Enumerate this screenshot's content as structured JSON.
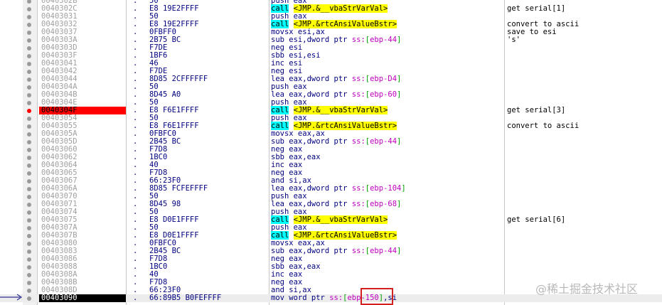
{
  "rows": [
    {
      "addr": "0040302B",
      "hex": "50",
      "asm": "push eax",
      "cmt": ""
    },
    {
      "addr": "0040302C",
      "hex": "E8 19E2FFFF",
      "asm": "call <JMP.&__vbaStrVarVal>",
      "cmt": "get serial[1]"
    },
    {
      "addr": "00403031",
      "hex": "50",
      "asm": "push eax",
      "cmt": ""
    },
    {
      "addr": "00403032",
      "hex": "E8 19E2FFFF",
      "asm": "call <JMP.&rtcAnsiValueBstr>",
      "cmt": "convert to ascii"
    },
    {
      "addr": "00403037",
      "hex": "0FBFF0",
      "asm": "movsx esi,ax",
      "cmt": "save to esi"
    },
    {
      "addr": "0040303A",
      "hex": "2B75 BC",
      "asm": "sub esi,dword ptr ss:[ebp-44]",
      "cmt": "'s'"
    },
    {
      "addr": "0040303D",
      "hex": "F7DE",
      "asm": "neg esi",
      "cmt": ""
    },
    {
      "addr": "0040303F",
      "hex": "1BF6",
      "asm": "sbb esi,esi",
      "cmt": ""
    },
    {
      "addr": "00403041",
      "hex": "46",
      "asm": "inc esi",
      "cmt": ""
    },
    {
      "addr": "00403042",
      "hex": "F7DE",
      "asm": "neg esi",
      "cmt": ""
    },
    {
      "addr": "00403044",
      "hex": "8D85 2CFFFFFF",
      "asm": "lea eax,dword ptr ss:[ebp-D4]",
      "cmt": ""
    },
    {
      "addr": "0040304A",
      "hex": "50",
      "asm": "push eax",
      "cmt": ""
    },
    {
      "addr": "0040304B",
      "hex": "8D45 A0",
      "asm": "lea eax,dword ptr ss:[ebp-60]",
      "cmt": ""
    },
    {
      "addr": "0040304E",
      "hex": "50",
      "asm": "push eax",
      "cmt": ""
    },
    {
      "addr": "0040304F",
      "hex": "E8 F6E1FFFF",
      "asm": "call <JMP.&__vbaStrVarVal>",
      "cmt": "get serial[3]"
    },
    {
      "addr": "00403054",
      "hex": "50",
      "asm": "push eax",
      "cmt": ""
    },
    {
      "addr": "00403055",
      "hex": "E8 F6E1FFFF",
      "asm": "call <JMP.&rtcAnsiValueBstr>",
      "cmt": "convert to ascii"
    },
    {
      "addr": "0040305A",
      "hex": "0FBFC0",
      "asm": "movsx eax,ax",
      "cmt": ""
    },
    {
      "addr": "0040305D",
      "hex": "2B45 BC",
      "asm": "sub eax,dword ptr ss:[ebp-44]",
      "cmt": ""
    },
    {
      "addr": "00403060",
      "hex": "F7D8",
      "asm": "neg eax",
      "cmt": ""
    },
    {
      "addr": "00403062",
      "hex": "1BC0",
      "asm": "sbb eax,eax",
      "cmt": ""
    },
    {
      "addr": "00403064",
      "hex": "40",
      "asm": "inc eax",
      "cmt": ""
    },
    {
      "addr": "00403065",
      "hex": "F7D8",
      "asm": "neg eax",
      "cmt": ""
    },
    {
      "addr": "00403067",
      "hex": "66:23F0",
      "asm": "and si,ax",
      "cmt": ""
    },
    {
      "addr": "0040306A",
      "hex": "8D85 FCFEFFFF",
      "asm": "lea eax,dword ptr ss:[ebp-104]",
      "cmt": ""
    },
    {
      "addr": "00403070",
      "hex": "50",
      "asm": "push eax",
      "cmt": ""
    },
    {
      "addr": "00403071",
      "hex": "8D45 98",
      "asm": "lea eax,dword ptr ss:[ebp-68]",
      "cmt": ""
    },
    {
      "addr": "00403074",
      "hex": "50",
      "asm": "push eax",
      "cmt": ""
    },
    {
      "addr": "00403075",
      "hex": "E8 D0E1FFFF",
      "asm": "call <JMP.&__vbaStrVarVal>",
      "cmt": "get serial[6]"
    },
    {
      "addr": "0040307A",
      "hex": "50",
      "asm": "push eax",
      "cmt": ""
    },
    {
      "addr": "0040307B",
      "hex": "E8 D0E1FFFF",
      "asm": "call <JMP.&rtcAnsiValueBstr>",
      "cmt": ""
    },
    {
      "addr": "00403080",
      "hex": "0FBFC0",
      "asm": "movsx eax,ax",
      "cmt": ""
    },
    {
      "addr": "00403083",
      "hex": "2B45 BC",
      "asm": "sub eax,dword ptr ss:[ebp-44]",
      "cmt": ""
    },
    {
      "addr": "00403086",
      "hex": "F7D8",
      "asm": "neg eax",
      "cmt": ""
    },
    {
      "addr": "00403088",
      "hex": "1BC0",
      "asm": "sbb eax,eax",
      "cmt": ""
    },
    {
      "addr": "0040308A",
      "hex": "40",
      "asm": "inc eax",
      "cmt": ""
    },
    {
      "addr": "0040308B",
      "hex": "F7D8",
      "asm": "neg eax",
      "cmt": ""
    },
    {
      "addr": "0040308D",
      "hex": "66:23F0",
      "asm": "and si,ax",
      "cmt": ""
    },
    {
      "addr": "00403090",
      "hex": "66:89B5 B0FEFFFF",
      "asm": "mov word ptr ss:[ebp-150],si",
      "cmt": ""
    }
  ],
  "watermark": "@稀土掘金技术社区",
  "colors": {
    "breakpoint": "#ff0000",
    "current_line": "#000000",
    "call_bg": "#00ffff",
    "target_bg": "#ffff00",
    "memory": "#c000c0",
    "highlight_box": "#d02020"
  },
  "breakpoint_row": 14,
  "current_row": 38
}
